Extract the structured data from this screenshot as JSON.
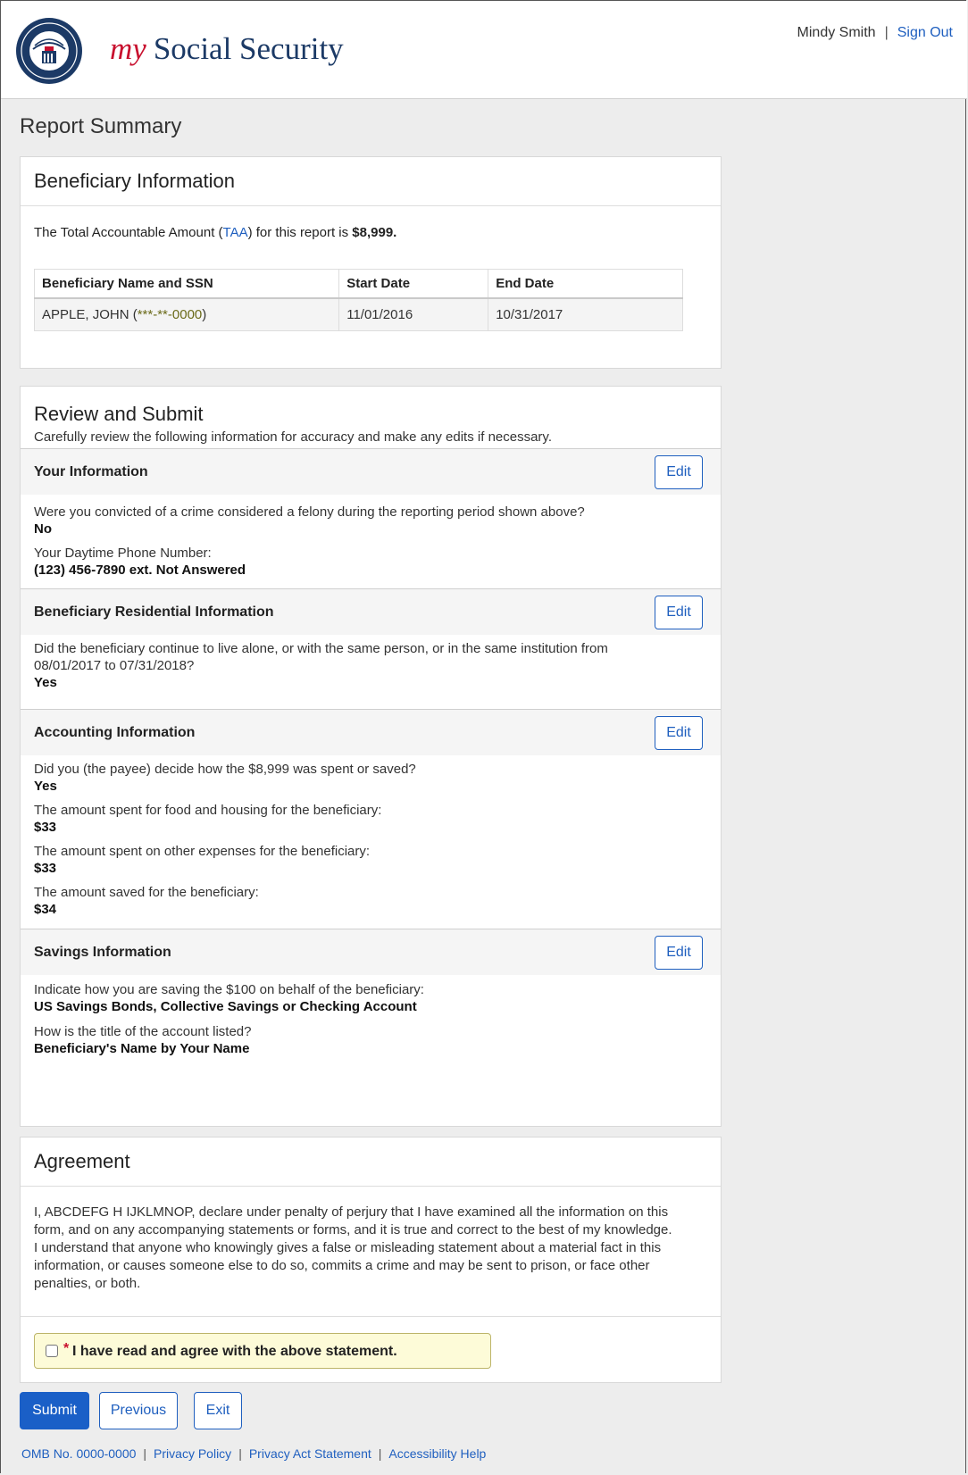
{
  "header": {
    "brand_my": "my",
    "brand_name": "Social Security",
    "user_name": "Mindy Smith",
    "separator": "|",
    "sign_out": "Sign Out"
  },
  "page_title": "Report Summary",
  "beneficiary": {
    "title": "Beneficiary Information",
    "taa_prefix": "The Total Accountable Amount (",
    "taa_link": "TAA",
    "taa_suffix": ") for this report is ",
    "taa_amount": "$8,999.",
    "table": {
      "headers": [
        "Beneficiary Name and SSN",
        "Start Date",
        "End Date"
      ],
      "rows": [
        {
          "name": "APPLE, JOHN (",
          "ssn": "***-**-0000",
          "close": ")",
          "start": "11/01/2016",
          "end": "10/31/2017"
        }
      ]
    }
  },
  "review": {
    "title": "Review and Submit",
    "description": "Carefully review the following information for accuracy and make any edits if necessary.",
    "edit_label": "Edit",
    "your_info": {
      "title": "Your Information",
      "q1": "Were you convicted of a crime considered a felony during the reporting period shown above?",
      "a1": "No",
      "q2": "Your Daytime Phone Number:",
      "a2": "(123) 456-7890 ext. Not Answered"
    },
    "residential": {
      "title": "Beneficiary Residential Information",
      "q1_line1": "Did the beneficiary continue to live alone, or with the same person, or in the same institution from",
      "q1_line2": "08/01/2017 to 07/31/2018?",
      "a1": "Yes"
    },
    "accounting": {
      "title": "Accounting Information",
      "q1": "Did you (the payee) decide how the $8,999 was spent or saved?",
      "a1": "Yes",
      "q2": "The amount spent for food and housing for the beneficiary:",
      "a2": "$33",
      "q3": "The amount spent on other expenses for the beneficiary:",
      "a3": "$33",
      "q4": "The amount saved for the beneficiary:",
      "a4": "$34"
    },
    "savings": {
      "title": "Savings Information",
      "q1": "Indicate how you are saving the $100 on behalf of the beneficiary:",
      "a1": "US Savings Bonds, Collective Savings or Checking Account",
      "q2": "How is the title of the account listed?",
      "a2": "Beneficiary's Name by Your Name"
    }
  },
  "agreement": {
    "title": "Agreement",
    "text": "I, ABCDEFG H IJKLMNOP, declare under penalty of perjury that I have examined all the information on this form, and on any accompanying statements or forms, and it is true and correct to the best of my knowledge. I understand that anyone who knowingly gives a false or misleading statement about a material fact in this information, or causes someone else to do so, commits a crime and may be sent to prison, or face other penalties, or both.",
    "required_mark": "*",
    "checkbox_label": "I have read and agree with the above statement."
  },
  "buttons": {
    "submit": "Submit",
    "previous": "Previous",
    "exit": "Exit"
  },
  "footer": {
    "omb": "OMB No. 0000-0000",
    "privacy_policy": "Privacy Policy",
    "privacy_act": "Privacy Act Statement",
    "accessibility": "Accessibility Help",
    "separator": "|"
  },
  "colors": {
    "brand_red": "#c8102e",
    "brand_navy": "#1c3a66",
    "link_blue": "#1f5fbf",
    "primary_button": "#1a5fc7"
  }
}
